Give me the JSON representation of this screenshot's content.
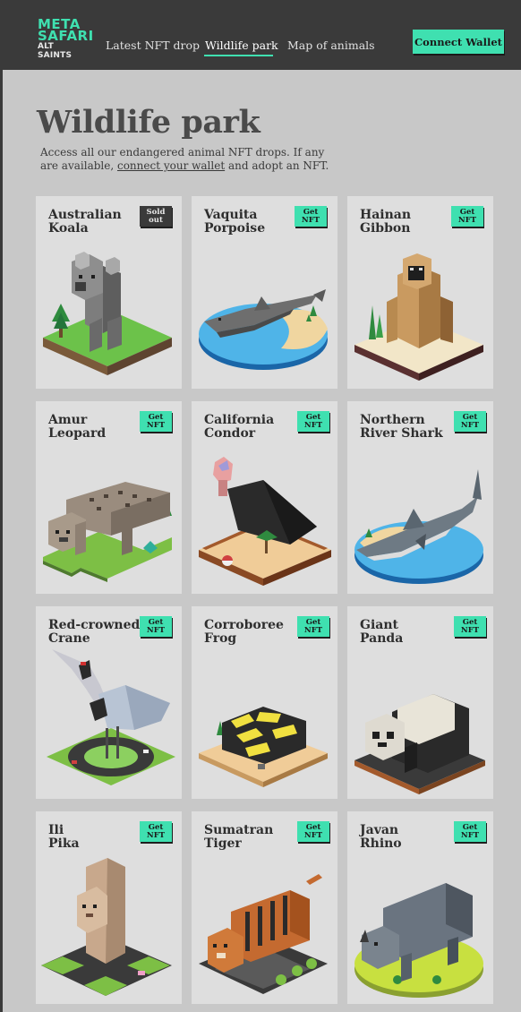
{
  "header": {
    "logo": {
      "line1": "META",
      "line2": "SAFARI",
      "line3": "ALT SAINTS"
    },
    "nav": [
      {
        "label": "Latest NFT drop",
        "active": false
      },
      {
        "label": "Wildlife park",
        "active": true
      },
      {
        "label": "Map of animals",
        "active": false
      }
    ],
    "connect_label": "Connect Wallet"
  },
  "page": {
    "title": "Wildlife park",
    "desc_before": "Access all our endangered animal NFT drops. If any are available, ",
    "desc_link": "connect your wallet",
    "desc_after": " and adopt an NFT."
  },
  "colors": {
    "accent": "#3fe0b0",
    "header_bg": "#3a3a3a",
    "page_bg": "#c8c8c8",
    "card_bg": "#dedede"
  },
  "animals": [
    {
      "line1": "Australian",
      "line2": "Koala",
      "badge1": "Sold",
      "badge2": "out",
      "status": "sold",
      "icon": "koala-illustration"
    },
    {
      "line1": "Vaquita",
      "line2": "Porpoise",
      "badge1": "Get",
      "badge2": "NFT",
      "status": "available",
      "icon": "vaquita-porpoise-illustration"
    },
    {
      "line1": "Hainan",
      "line2": "Gibbon",
      "badge1": "Get",
      "badge2": "NFT",
      "status": "available",
      "icon": "gibbon-illustration"
    },
    {
      "line1": "Amur",
      "line2": "Leopard",
      "badge1": "Get",
      "badge2": "NFT",
      "status": "available",
      "icon": "leopard-illustration"
    },
    {
      "line1": "California",
      "line2": "Condor",
      "badge1": "Get",
      "badge2": "NFT",
      "status": "available",
      "icon": "condor-illustration"
    },
    {
      "line1": "Northern",
      "line2": "River Shark",
      "badge1": "Get",
      "badge2": "NFT",
      "status": "available",
      "icon": "shark-illustration"
    },
    {
      "line1": "Red-crowned",
      "line2": "Crane",
      "badge1": "Get",
      "badge2": "NFT",
      "status": "available",
      "icon": "crane-illustration"
    },
    {
      "line1": "Corroboree",
      "line2": "Frog",
      "badge1": "Get",
      "badge2": "NFT",
      "status": "available",
      "icon": "frog-illustration"
    },
    {
      "line1": "Giant",
      "line2": "Panda",
      "badge1": "Get",
      "badge2": "NFT",
      "status": "available",
      "icon": "panda-illustration"
    },
    {
      "line1": "Ili",
      "line2": "Pika",
      "badge1": "Get",
      "badge2": "NFT",
      "status": "available",
      "icon": "pika-illustration"
    },
    {
      "line1": "Sumatran",
      "line2": "Tiger",
      "badge1": "Get",
      "badge2": "NFT",
      "status": "available",
      "icon": "tiger-illustration"
    },
    {
      "line1": "Javan",
      "line2": "Rhino",
      "badge1": "Get",
      "badge2": "NFT",
      "status": "available",
      "icon": "rhino-illustration"
    }
  ]
}
